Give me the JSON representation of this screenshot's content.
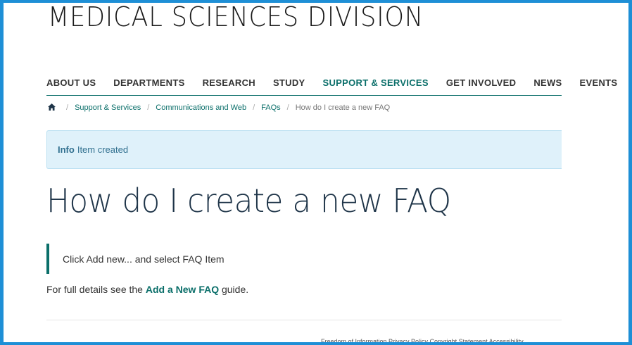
{
  "site": {
    "title": "MEDICAL SCIENCES DIVISION"
  },
  "nav": {
    "items": [
      {
        "label": "ABOUT US"
      },
      {
        "label": "DEPARTMENTS"
      },
      {
        "label": "RESEARCH"
      },
      {
        "label": "STUDY"
      },
      {
        "label": "SUPPORT & SERVICES",
        "active": true
      },
      {
        "label": "GET INVOLVED"
      },
      {
        "label": "NEWS"
      },
      {
        "label": "EVENTS"
      }
    ],
    "active_color": "#0b6f6a"
  },
  "breadcrumb": {
    "home_icon": "home-icon",
    "items": [
      "Support & Services",
      "Communications and Web",
      "FAQs"
    ],
    "current": "How do I create a new FAQ",
    "separator": "/"
  },
  "alert": {
    "label": "Info",
    "message": "Item created"
  },
  "page": {
    "title": "How do I create a new FAQ",
    "quote": "Click Add new... and select FAQ Item",
    "details_prefix": "For full details see the ",
    "details_link": "Add a New FAQ",
    "details_suffix": " guide."
  },
  "footer": {
    "text": "Freedom of Information   Privacy Policy   Copyright Statement   Accessibility"
  },
  "colors": {
    "frame": "#1e8fd6",
    "accent": "#0b6f6a",
    "alert_bg": "#dff1fa",
    "title": "#1e3448"
  }
}
